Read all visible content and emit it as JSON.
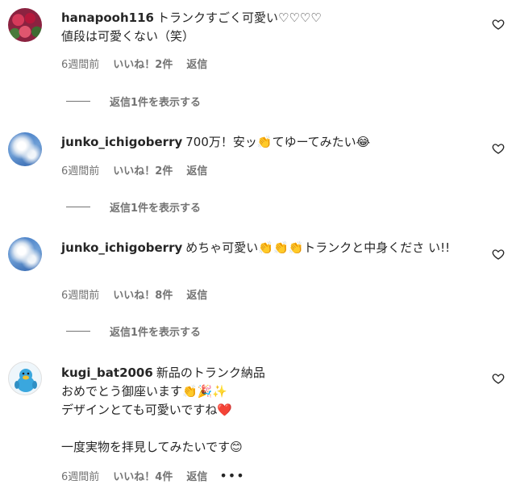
{
  "comments": [
    {
      "username": "hanapooh116",
      "text": "トランクすごく可愛い♡♡♡♡\n値段は可愛くない（笑）",
      "time": "6週間前",
      "likes": "いいね！2件",
      "reply": "返信",
      "view_replies": "返信1件を表示する",
      "avatar_icon": "flower-avatar"
    },
    {
      "username": "junko_ichigoberry",
      "text": "700万！安ッ👏てゆーてみたい😂",
      "time": "6週間前",
      "likes": "いいね！2件",
      "reply": "返信",
      "view_replies": "返信1件を表示する",
      "avatar_icon": "sky-avatar"
    },
    {
      "username": "junko_ichigoberry",
      "text": "めちゃ可愛い👏👏👏トランクと中身くださ い!!",
      "time": "6週間前",
      "likes": "いいね！8件",
      "reply": "返信",
      "view_replies": "返信1件を表示する",
      "avatar_icon": "sky-avatar"
    },
    {
      "username": "kugi_bat2006",
      "text": "新品のトランク納品\nおめでとう御座います👏🎉✨\nデザインとても可愛いですね❤️\n\n一度実物を拝見してみたいです😊",
      "time": "6週間前",
      "likes": "いいね！4件",
      "reply": "返信",
      "more": "•••",
      "avatar_icon": "bird-avatar"
    }
  ]
}
